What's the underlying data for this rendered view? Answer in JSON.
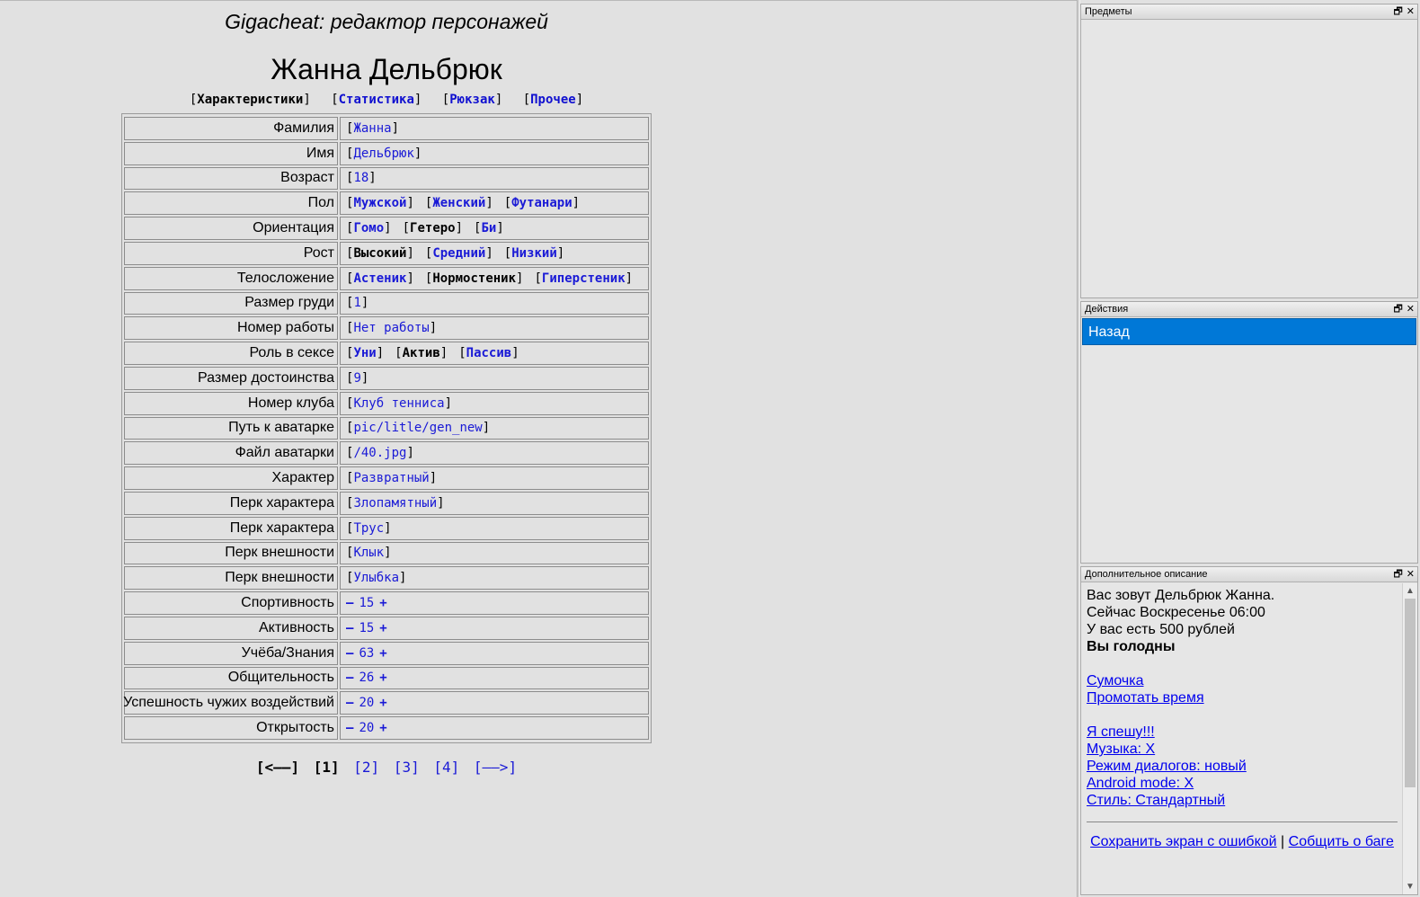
{
  "app_title": "Gigacheat: редактор персонажей",
  "character_name": "Жанна Дельбрюк",
  "tabs": [
    {
      "label": "Характеристики",
      "current": true
    },
    {
      "label": "Статистика",
      "current": false
    },
    {
      "label": "Рюкзак",
      "current": false
    },
    {
      "label": "Прочее",
      "current": false
    }
  ],
  "rows": {
    "surname": {
      "label": "Фамилия",
      "value": "Жанна"
    },
    "name": {
      "label": "Имя",
      "value": "Дельбрюк"
    },
    "age": {
      "label": "Возраст",
      "value": "18"
    },
    "gender": {
      "label": "Пол",
      "options": [
        "Мужской",
        "Женский",
        "Футанари"
      ],
      "selected": -1
    },
    "orientation": {
      "label": "Ориентация",
      "options": [
        "Гомо",
        "Гетеро",
        "Би"
      ],
      "selected": 1
    },
    "height": {
      "label": "Рост",
      "options": [
        "Высокий",
        "Средний",
        "Низкий"
      ],
      "selected": 0
    },
    "build": {
      "label": "Телосложение",
      "options": [
        "Астеник",
        "Нормостеник",
        "Гиперстеник"
      ],
      "selected": 1
    },
    "breast": {
      "label": "Размер груди",
      "value": "1"
    },
    "job": {
      "label": "Номер работы",
      "value": "Нет работы"
    },
    "role": {
      "label": "Роль в сексе",
      "options": [
        "Уни",
        "Актив",
        "Пассив"
      ],
      "selected": 1
    },
    "dignity": {
      "label": "Размер достоинства",
      "value": "9"
    },
    "club": {
      "label": "Номер клуба",
      "value": "Клуб тенниса"
    },
    "avatar_path": {
      "label": "Путь к аватарке",
      "value": "pic/litle/gen_new"
    },
    "avatar_file": {
      "label": "Файл аватарки",
      "value": "/40.jpg"
    },
    "character": {
      "label": "Характер",
      "value": "Развратный"
    },
    "perk1": {
      "label": "Перк характера",
      "value": "Злопамятный"
    },
    "perk2": {
      "label": "Перк характера",
      "value": "Трус"
    },
    "look1": {
      "label": "Перк внешности",
      "value": "Клык"
    },
    "look2": {
      "label": "Перк внешности",
      "value": "Улыбка"
    },
    "sport": {
      "label": "Спортивность",
      "value": "15"
    },
    "activity": {
      "label": "Активность",
      "value": "15"
    },
    "study": {
      "label": "Учёба/Знания",
      "value": "63"
    },
    "social": {
      "label": "Общительность",
      "value": "26"
    },
    "influence": {
      "label": "Успешность чужих воздействий",
      "value": "20"
    },
    "openness": {
      "label": "Открытость",
      "value": "20"
    }
  },
  "stepper": {
    "minus": "–",
    "plus": "+"
  },
  "brackets": {
    "open": "[",
    "close": "]"
  },
  "pager": {
    "prev": "[<——]",
    "current": "[1]",
    "p2": "[2]",
    "p3": "[3]",
    "p4": "[4]",
    "next": "[——>]"
  },
  "panels": {
    "items": {
      "title": "Предметы"
    },
    "actions": {
      "title": "Действия",
      "items": [
        "Назад"
      ]
    },
    "desc": {
      "title": "Дополнительное описание",
      "line1": "Вас зовут Дельбрюк Жанна.",
      "line2": "Сейчас Воскресенье 06:00",
      "line3": "У вас есть 500 рублей",
      "line4": "Вы голодны",
      "link_bag": "Сумочка",
      "link_skip": "Промотать время",
      "link_hurry": "Я спешу!!!",
      "link_music": "Музыка: X",
      "link_dialog": "Режим диалогов: новый",
      "link_android": "Android mode: X",
      "link_style": "Стиль: Стандартный",
      "link_save": "Сохранить экран с ошибкой",
      "separator": "|",
      "link_report": "Собщить о баге"
    },
    "ctrl_restore": "🗗",
    "ctrl_close": "✕"
  }
}
